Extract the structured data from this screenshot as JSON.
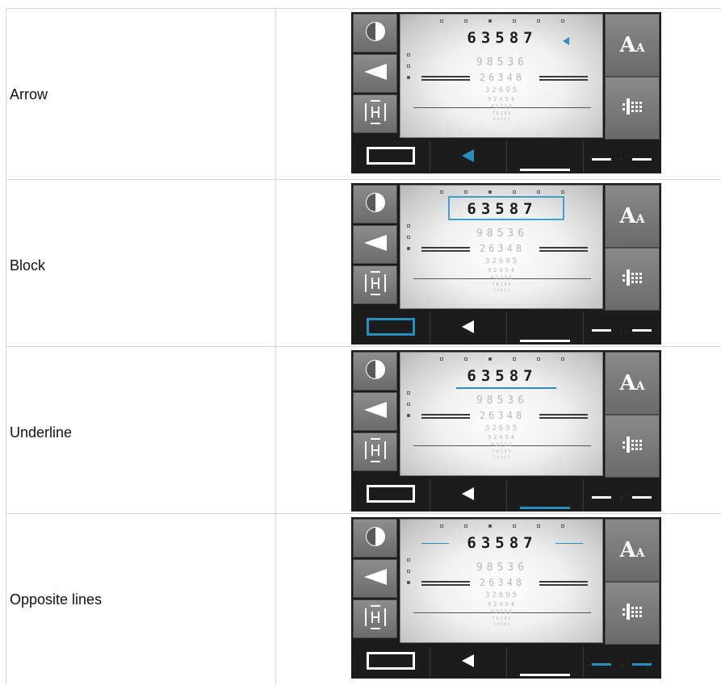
{
  "rows": [
    {
      "label": "Arrow",
      "style": "arrow"
    },
    {
      "label": "Block",
      "style": "block"
    },
    {
      "label": "Underline",
      "style": "underline"
    },
    {
      "label": "Opposite lines",
      "style": "opposite"
    }
  ],
  "chart": {
    "top_digits": "63587",
    "line2": "98536",
    "line3": "26348",
    "line4": "32695",
    "line5": "92454",
    "line6": "43756",
    "line7": "78185",
    "line8": "34962"
  },
  "right_buttons": {
    "font_size_label": "A",
    "font_size_small": "A"
  },
  "icons": {
    "contrast": "contrast-icon",
    "arrow": "arrow-left-icon",
    "split_h": "split-h-icon",
    "text_size": "text-size-icon",
    "grid": "grid-icon",
    "block": "block-highlight-icon",
    "underline": "underline-highlight-icon",
    "opposite": "opposite-lines-icon"
  },
  "colors": {
    "accent": "#2a8ec0",
    "panel": "#1b1b1b",
    "button": "#7a7a7a"
  }
}
